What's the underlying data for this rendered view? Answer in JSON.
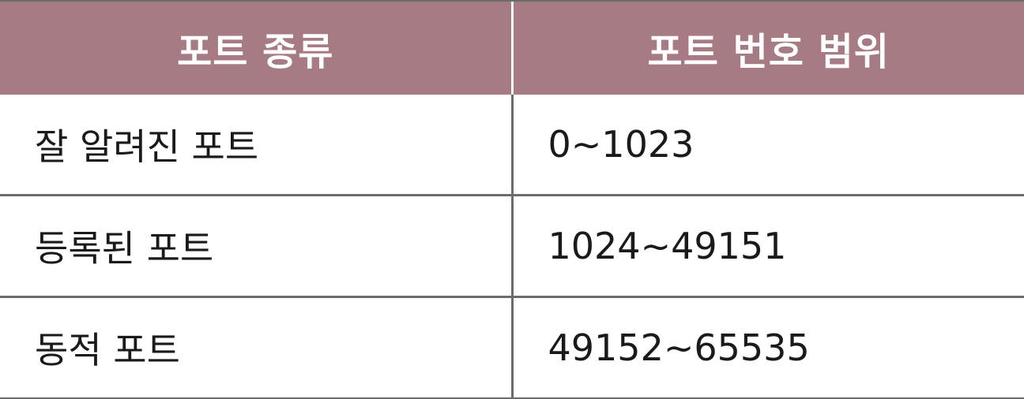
{
  "table": {
    "headers": [
      "포트 종류",
      "포트 번호 범위"
    ],
    "rows": [
      [
        "잘 알려진 포트",
        "0~1023"
      ],
      [
        "등록된 포트",
        "1024~49151"
      ],
      [
        "동적 포트",
        "49152~65535"
      ]
    ]
  },
  "colors": {
    "header_bg": "#a77b84",
    "header_text": "#ffffff",
    "body_text": "#1a1a1a",
    "grid": "#6b6b6b"
  }
}
